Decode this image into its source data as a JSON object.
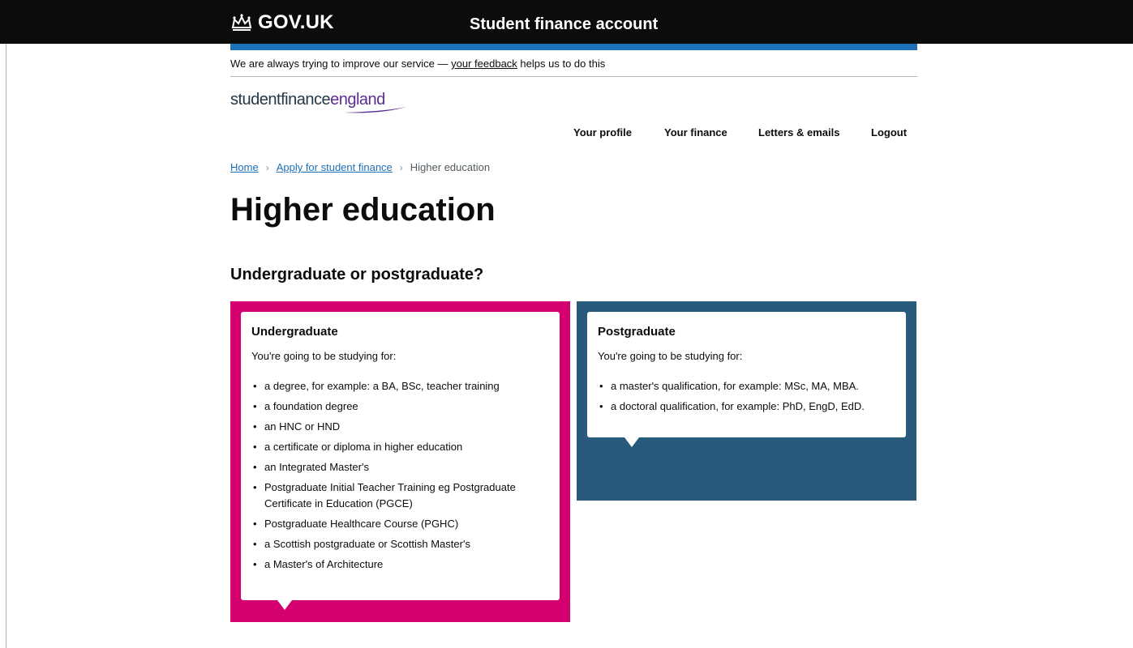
{
  "header": {
    "logotype": "GOV.UK",
    "service_name": "Student finance account"
  },
  "feedback": {
    "prefix": "We are always trying to improve our service — ",
    "link": "your feedback",
    "suffix": " helps us to do this"
  },
  "brand": {
    "part1": "studentfinance",
    "part2": "england"
  },
  "nav": {
    "profile": "Your profile",
    "finance": "Your finance",
    "letters": "Letters & emails",
    "logout": "Logout"
  },
  "breadcrumb": {
    "home": "Home",
    "apply": "Apply for student finance",
    "current": "Higher education"
  },
  "page_title": "Higher education",
  "section_title": "Undergraduate or postgraduate?",
  "undergraduate": {
    "title": "Undergraduate",
    "intro": "You're going to be studying for:",
    "items": [
      "a degree, for example: a BA, BSc, teacher training",
      "a foundation degree",
      "an HNC or HND",
      "a certificate or diploma in higher education",
      "an Integrated Master's",
      "Postgraduate Initial Teacher Training eg Postgraduate Certificate in Education (PGCE)",
      "Postgraduate Healthcare Course (PGHC)",
      "a Scottish postgraduate or Scottish Master's",
      "a Master's of Architecture"
    ]
  },
  "postgraduate": {
    "title": "Postgraduate",
    "intro": "You're going to be studying for:",
    "items": [
      "a master's qualification, for example: MSc, MA, MBA.",
      "a doctoral qualification, for example: PhD, EngD, EdD."
    ]
  },
  "colors": {
    "header_bg": "#0b0c0c",
    "header_accent": "#1d70b8",
    "undergraduate_panel": "#d4006f",
    "postgraduate_panel": "#285a7b"
  }
}
